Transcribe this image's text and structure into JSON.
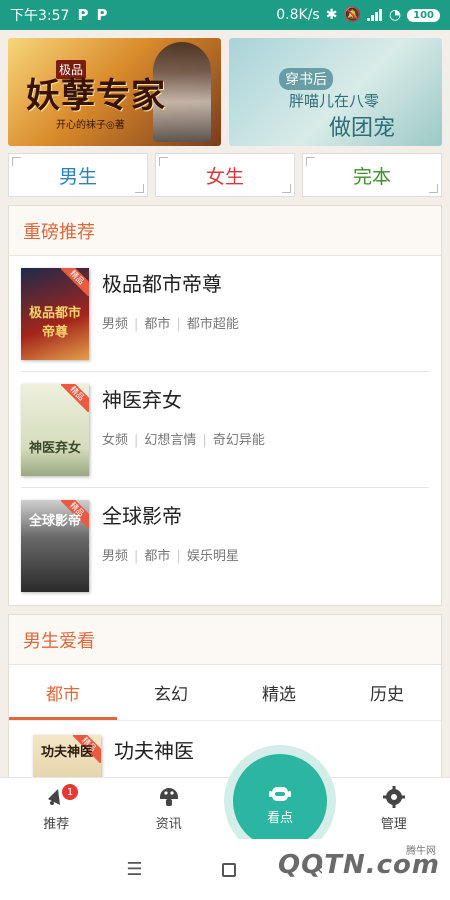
{
  "status": {
    "time": "下午3:57",
    "p1": "P",
    "p2": "P",
    "speed": "0.8K/s",
    "battery": "100"
  },
  "banners": {
    "left": {
      "tag": "极品",
      "title": "妖孽专家",
      "author": "开心的袜子◎著"
    },
    "right": {
      "sub": "穿书后",
      "line1": "胖喵儿在八零",
      "line2": "做团宠"
    }
  },
  "categories": [
    "男生",
    "女生",
    "完本"
  ],
  "category_colors": [
    "#2a84b5",
    "#d9383a",
    "#3d8f2b"
  ],
  "recommend": {
    "title": "重磅推荐",
    "books": [
      {
        "title": "极品都市帝尊",
        "tags": [
          "男频",
          "都市",
          "都市超能"
        ],
        "cover_text": "极品都市帝尊",
        "cover_color": "#a3251c"
      },
      {
        "title": "神医弃女",
        "tags": [
          "女频",
          "幻想言情",
          "奇幻异能"
        ],
        "cover_text": "神医弃女",
        "cover_color": "#dfe6c9"
      },
      {
        "title": "全球影帝",
        "tags": [
          "男频",
          "都市",
          "娱乐明星"
        ],
        "cover_text": "全球影帝",
        "cover_color": "#4a4a4a"
      }
    ],
    "ribbon": "精品"
  },
  "male": {
    "title": "男生爱看",
    "tabs": [
      "都市",
      "玄幻",
      "精选",
      "历史"
    ],
    "books": [
      {
        "title": "功夫神医",
        "cover_text": "功夫神医",
        "cover_color": "#e8d9b5"
      }
    ]
  },
  "bottom_nav": {
    "items": [
      "推荐",
      "资讯",
      "看点",
      "管理"
    ],
    "badge": "1"
  },
  "watermark": {
    "text": "QQTN.com",
    "small": "腾牛网"
  }
}
